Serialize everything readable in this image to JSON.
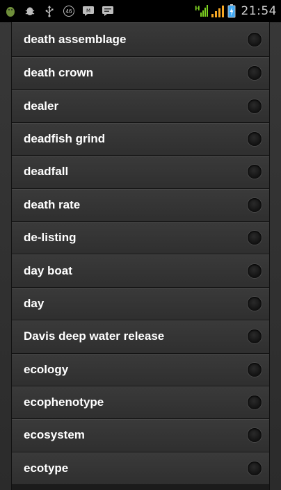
{
  "status_bar": {
    "clock": "21:54",
    "network_type": "H",
    "badge_text": "46",
    "icons": [
      "android-icon",
      "bug-icon",
      "usb-icon",
      "badge-46-icon",
      "message-icon",
      "chat-icon"
    ]
  },
  "list": {
    "items": [
      {
        "label": "death assemblage"
      },
      {
        "label": "death crown"
      },
      {
        "label": "dealer"
      },
      {
        "label": "deadfish grind"
      },
      {
        "label": "deadfall"
      },
      {
        "label": "death rate"
      },
      {
        "label": "de-listing"
      },
      {
        "label": "day boat"
      },
      {
        "label": "day"
      },
      {
        "label": "Davis deep water release"
      },
      {
        "label": "ecology"
      },
      {
        "label": "ecophenotype"
      },
      {
        "label": "ecosystem"
      },
      {
        "label": "ecotype"
      }
    ]
  },
  "colors": {
    "background": "#2e2e2e",
    "item_text": "#ffffff",
    "status_bar": "#000000",
    "signal_green": "#7ed321",
    "signal_orange": "#f5a623",
    "battery_blue": "#3fa9f5"
  }
}
